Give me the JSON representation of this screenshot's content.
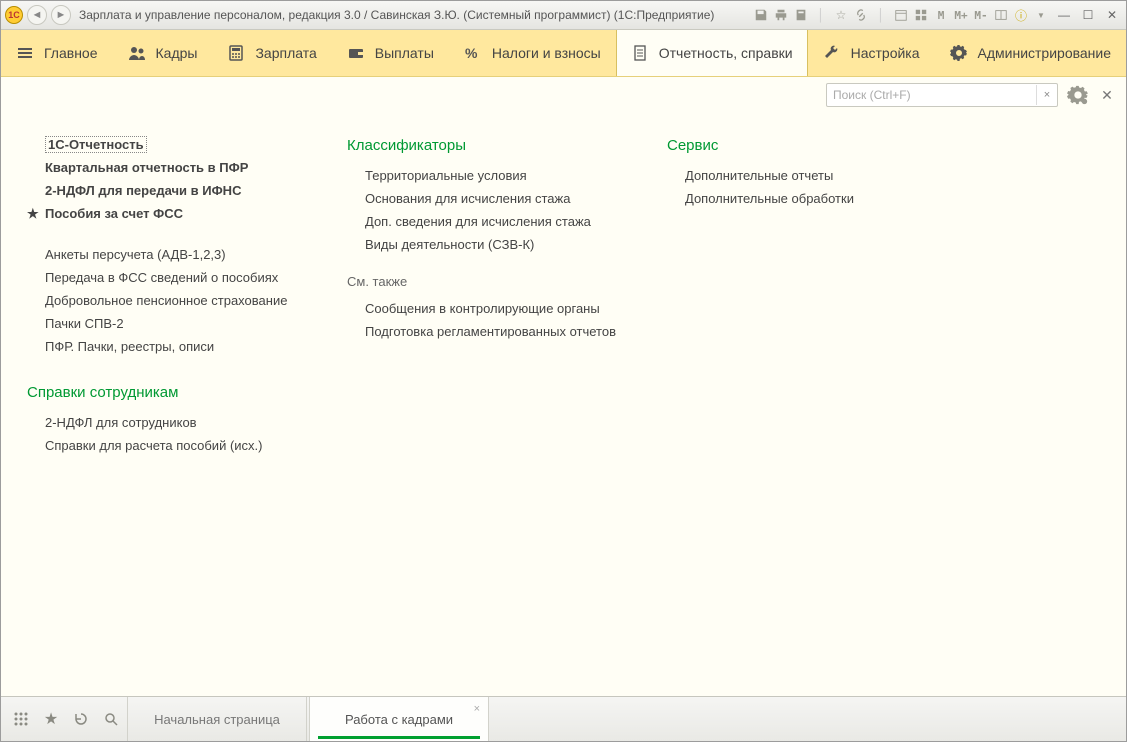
{
  "titlebar": {
    "app_logo_text": "1C",
    "title": "Зарплата и управление персоналом, редакция 3.0 / Савинская З.Ю. (Системный программист)  (1С:Предприятие)",
    "m_labels": [
      "M",
      "M+",
      "M-"
    ]
  },
  "nav": {
    "items": [
      {
        "label": "Главное"
      },
      {
        "label": "Кадры"
      },
      {
        "label": "Зарплата"
      },
      {
        "label": "Выплаты"
      },
      {
        "label": "Налоги и взносы"
      },
      {
        "label": "Отчетность, справки"
      },
      {
        "label": "Настройка"
      },
      {
        "label": "Администрирование"
      }
    ],
    "active_index": 5
  },
  "search": {
    "placeholder": "Поиск (Ctrl+F)"
  },
  "columns": {
    "col1": {
      "primary_links": [
        {
          "label": "1С-Отчетность",
          "selected": true
        },
        {
          "label": "Квартальная отчетность в ПФР"
        },
        {
          "label": "2-НДФЛ для передачи в ИФНС"
        },
        {
          "label": "Пособия за счет ФСС",
          "starred": true
        }
      ],
      "secondary_links": [
        "Анкеты персучета (АДВ-1,2,3)",
        "Передача в ФСС сведений о пособиях",
        "Добровольное пенсионное страхование",
        "Пачки СПВ-2",
        "ПФР. Пачки, реестры, описи"
      ],
      "section2_title": "Справки сотрудникам",
      "section2_links": [
        "2-НДФЛ для сотрудников",
        "Справки для расчета пособий (исх.)"
      ]
    },
    "col2": {
      "title": "Классификаторы",
      "links": [
        "Территориальные условия",
        "Основания для исчисления стажа",
        "Доп. сведения для исчисления стажа",
        "Виды деятельности (СЗВ-К)"
      ],
      "see_also_label": "См. также",
      "see_also_links": [
        "Сообщения в контролирующие органы",
        "Подготовка регламентированных отчетов"
      ]
    },
    "col3": {
      "title": "Сервис",
      "links": [
        "Дополнительные отчеты",
        "Дополнительные обработки"
      ]
    }
  },
  "bottom_tabs": {
    "tabs": [
      {
        "label": "Начальная страница",
        "active": false
      },
      {
        "label": "Работа с кадрами",
        "active": true
      }
    ]
  }
}
